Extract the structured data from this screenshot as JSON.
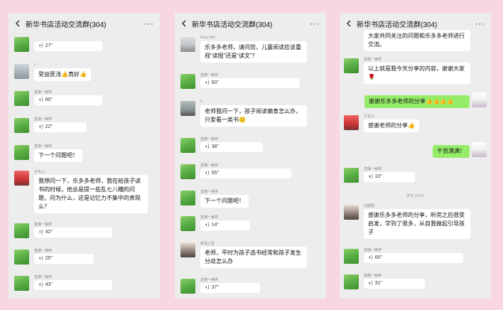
{
  "panels": [
    {
      "title": "新华书店活动交流群(304)",
      "messages": [
        {
          "sender": "",
          "type": "voice",
          "duration": "27\""
        },
        {
          "sender": "L...",
          "type": "text",
          "text": "受益匪浅👍真好👍"
        },
        {
          "sender": "直播一美婷",
          "type": "voice",
          "duration": "60\""
        },
        {
          "sender": "直播一美婷",
          "type": "voice",
          "duration": "22\""
        },
        {
          "sender": "直播一美婷",
          "type": "text",
          "text": "下一个问题吧！"
        },
        {
          "sender": "子实儿",
          "type": "text",
          "text": "我想问一下，乐多多老师，我在给孩子读书的时候，他总是提一些乱七八糟的问题，问为什么，这是记忆力不集中的表现么？"
        },
        {
          "sender": "直播一美婷",
          "type": "voice",
          "duration": "42\""
        },
        {
          "sender": "直播一美婷",
          "type": "voice",
          "duration": "25\""
        },
        {
          "sender": "直播一美婷",
          "type": "voice",
          "duration": "43\""
        }
      ]
    },
    {
      "title": "新华书店活动交流群(304)",
      "messages": [
        {
          "sender": "Foxy Wei",
          "type": "text",
          "text": "乐多多老师，请问您，儿童阅读应该重视“读图”还是“读文”？"
        },
        {
          "sender": "直播一美婷",
          "type": "voice",
          "duration": "60\""
        },
        {
          "sender": "L...",
          "type": "text",
          "text": "老师我问一下，孩子阅读偏食怎么办，只爱看一类书🙂"
        },
        {
          "sender": "直播一美婷",
          "type": "voice",
          "duration": "38\""
        },
        {
          "sender": "直播一美婷",
          "type": "voice",
          "duration": "55\""
        },
        {
          "sender": "直播一美婷",
          "type": "text",
          "text": "下一个问题吧！"
        },
        {
          "sender": "直播一美婷",
          "type": "voice",
          "duration": "14\""
        },
        {
          "sender": "新悦之星",
          "type": "text",
          "text": "老师，平时为孩子选书经常和孩子发生分歧怎么办"
        },
        {
          "sender": "直播一美婷",
          "type": "voice",
          "duration": "37\""
        }
      ]
    },
    {
      "title": "新华书店活动交流群(304)",
      "messages": [
        {
          "sender": "",
          "type": "text",
          "text": "大家共同关注的问题和乐多多老师进行交流。"
        },
        {
          "sender": "直播一美婷",
          "type": "text",
          "text": "以上就是我今天分享的内容，谢谢大家🌹"
        },
        {
          "sender": "",
          "type": "self",
          "text": "谢谢乐多多老师的分享👍👍👍👍"
        },
        {
          "sender": "子实儿",
          "type": "text",
          "text": "感谢老师的分享👍"
        },
        {
          "sender": "",
          "type": "self",
          "text": "干货满满！"
        },
        {
          "sender": "直播一美婷",
          "type": "voice",
          "duration": "10\""
        },
        {
          "sender": "",
          "type": "time",
          "text": "昨天 23:40"
        },
        {
          "sender": "刘丽霞",
          "type": "text",
          "text": "感谢乐多多老师的分享，听完之后很受启发，学到了很多，从自我做起引导孩子"
        },
        {
          "sender": "直播一美婷",
          "type": "voice",
          "duration": "60\""
        },
        {
          "sender": "直播一美婷",
          "type": "voice",
          "duration": "31\""
        }
      ]
    }
  ]
}
